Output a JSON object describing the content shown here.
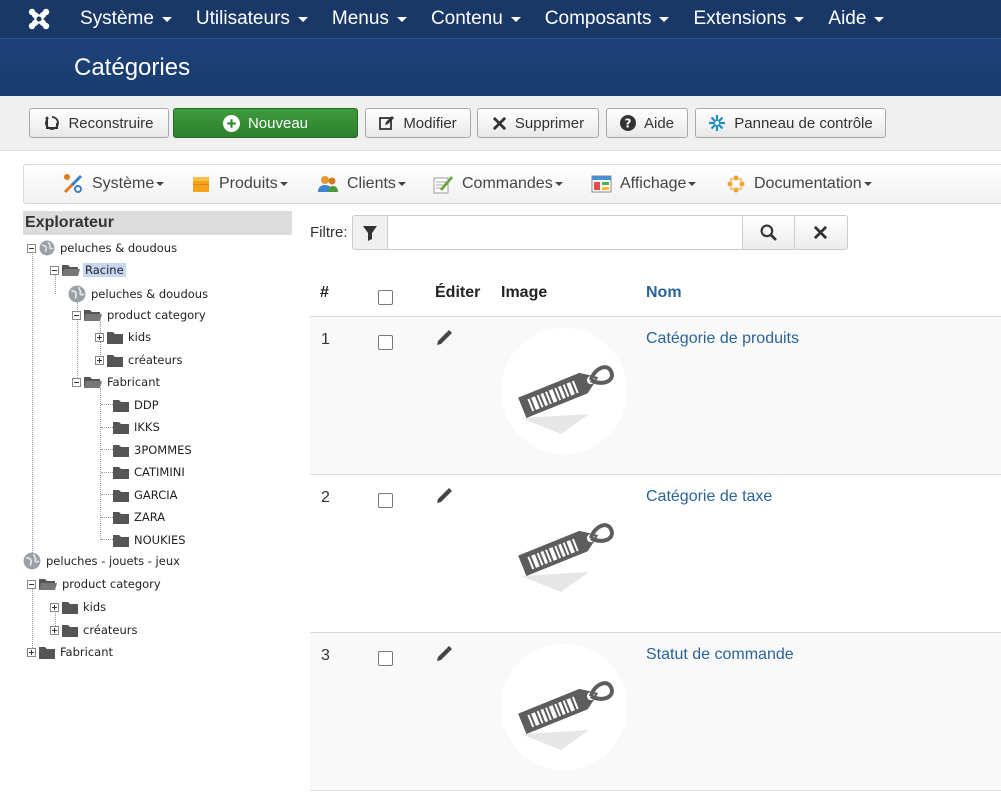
{
  "topnav": {
    "logo_icon": "joomla-logo-icon",
    "items": [
      {
        "label": "Système"
      },
      {
        "label": "Utilisateurs"
      },
      {
        "label": "Menus"
      },
      {
        "label": "Contenu"
      },
      {
        "label": "Composants"
      },
      {
        "label": "Extensions"
      },
      {
        "label": "Aide"
      }
    ]
  },
  "page": {
    "title": "Catégories"
  },
  "toolbar": {
    "rebuild_label": "Reconstruire",
    "new_label": "Nouveau",
    "edit_label": "Modifier",
    "delete_label": "Supprimer",
    "help_label": "Aide",
    "cpanel_label": "Panneau de contrôle"
  },
  "submenu": {
    "items": [
      {
        "label": "Système",
        "icon": "tools-icon"
      },
      {
        "label": "Produits",
        "icon": "box-icon"
      },
      {
        "label": "Clients",
        "icon": "users-icon"
      },
      {
        "label": "Commandes",
        "icon": "order-icon"
      },
      {
        "label": "Affichage",
        "icon": "display-icon"
      },
      {
        "label": "Documentation",
        "icon": "documentation-icon"
      }
    ]
  },
  "explorer": {
    "title": "Explorateur",
    "nodes": [
      {
        "label": "peluches & doudous"
      },
      {
        "label": "Racine"
      },
      {
        "label": "peluches & doudous"
      },
      {
        "label": "product category"
      },
      {
        "label": "kids"
      },
      {
        "label": "créateurs"
      },
      {
        "label": "Fabricant"
      },
      {
        "label": "DDP"
      },
      {
        "label": "IKKS"
      },
      {
        "label": "3POMMES"
      },
      {
        "label": "CATIMINI"
      },
      {
        "label": "GARCIA"
      },
      {
        "label": "ZARA"
      },
      {
        "label": "NOUKIES"
      },
      {
        "label": "peluches - jouets - jeux"
      },
      {
        "label": "product category"
      },
      {
        "label": "kids"
      },
      {
        "label": "créateurs"
      },
      {
        "label": "Fabricant"
      }
    ]
  },
  "filter": {
    "label": "Filtre:",
    "value": ""
  },
  "table": {
    "headers": {
      "num": "#",
      "edit": "Éditer",
      "image": "Image",
      "name": "Nom"
    },
    "rows": [
      {
        "num": "1",
        "name": "Catégorie de produits"
      },
      {
        "num": "2",
        "name": "Catégorie de taxe"
      },
      {
        "num": "3",
        "name": "Statut de commande"
      }
    ]
  }
}
